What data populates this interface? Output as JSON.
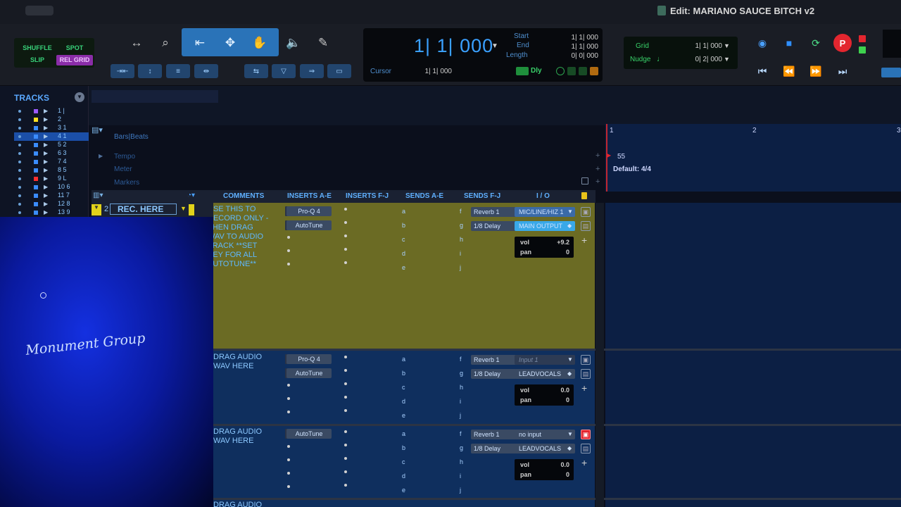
{
  "window": {
    "title": "Edit: MARIANO SAUCE BITCH v2"
  },
  "modes": {
    "shuffle": "SHUFFLE",
    "spot": "SPOT",
    "slip": "SLIP",
    "grid": "REL GRID"
  },
  "counter": {
    "main": "1| 1| 000",
    "start_label": "Start",
    "start": "1| 1| 000",
    "end_label": "End",
    "end": "1| 1| 000",
    "length_label": "Length",
    "length": "0| 0| 000",
    "cursor_label": "Cursor",
    "cursor": "1| 1| 000",
    "dly": "Dly"
  },
  "grid": {
    "grid_label": "Grid",
    "grid_value": "1| 1| 000",
    "nudge_label": "Nudge",
    "nudge_value": "0| 2| 000"
  },
  "tracks_panel": {
    "title": "TRACKS",
    "items": [
      {
        "name": "1 |",
        "color": "#9b59ff"
      },
      {
        "name": "2",
        "color": "#ffe020"
      },
      {
        "name": "3 1",
        "color": "#3b8cff"
      },
      {
        "name": "4 1",
        "color": "#3b8cff"
      },
      {
        "name": "5 2",
        "color": "#3b8cff"
      },
      {
        "name": "6 3",
        "color": "#3b8cff"
      },
      {
        "name": "7 4",
        "color": "#3b8cff"
      },
      {
        "name": "8 5",
        "color": "#3b8cff"
      },
      {
        "name": "9 L",
        "color": "#ff3030"
      },
      {
        "name": "10 6",
        "color": "#3b8cff"
      },
      {
        "name": "11 7",
        "color": "#3b8cff"
      },
      {
        "name": "12 8",
        "color": "#3b8cff"
      },
      {
        "name": "13 9",
        "color": "#3b8cff"
      }
    ]
  },
  "rulers": {
    "bars_beats": "Bars|Beats",
    "tempo": "Tempo",
    "meter": "Meter",
    "markers": "Markers",
    "bar1": "1",
    "bar2": "2",
    "bar3": "3",
    "tempo_value": "55",
    "meter_value": "Default: 4/4"
  },
  "columns": {
    "comments": "COMMENTS",
    "inserts_ae": "INSERTS A-E",
    "inserts_fj": "INSERTS F-J",
    "sends_ae": "SENDS A-E",
    "sends_fj": "SENDS F-J",
    "io": "I / O"
  },
  "rec_track": {
    "number": "2",
    "name": "REC. HERE"
  },
  "video": {
    "logo": "Monument Group"
  },
  "track_rows": [
    {
      "comment": "USE THIS TO\nRECORD ONLY -\nTHEN DRAG\nWAV TO AUDIO\nTRACK **SET\nKEY FOR ALL\nAUTOTUNE**",
      "insert1": "Pro-Q 4",
      "insert2": "AutoTune",
      "send_f": "Reverb 1",
      "send_g": "1/8 Delay",
      "io_in": "MIC/LINE/HIZ 1",
      "io_out": "MAIN OUTPUT",
      "vol": "+9.2",
      "pan": "0"
    },
    {
      "comment": "DRAG AUDIO\nWAV HERE",
      "insert1": "Pro-Q 4",
      "insert2": "AutoTune",
      "send_f": "Reverb 1",
      "send_g": "1/8 Delay",
      "io_in": "Input 1",
      "io_out": "LEADVOCALS",
      "vol": "0.0",
      "pan": "0"
    },
    {
      "comment": "DRAG AUDIO\nWAV HERE",
      "insert1": "AutoTune",
      "insert2": "",
      "send_f": "Reverb 1",
      "send_g": "1/8 Delay",
      "io_in": "no input",
      "io_out": "LEADVOCALS",
      "vol": "0.0",
      "pan": "0"
    },
    {
      "comment": "DRAG AUDIO"
    }
  ],
  "labels": {
    "vol": "vol",
    "pan": "pan",
    "send_a": "a",
    "send_b": "b",
    "send_c": "c",
    "send_d": "d",
    "send_e": "e",
    "send_f": "f",
    "send_g": "g",
    "send_h": "h",
    "send_i": "i",
    "send_j": "j"
  },
  "colors": {
    "accent": "#3aa0ff",
    "rec_track_bg": "#6b6b24",
    "timeline_bg": "#0c1f44",
    "record": "#e3262f"
  }
}
